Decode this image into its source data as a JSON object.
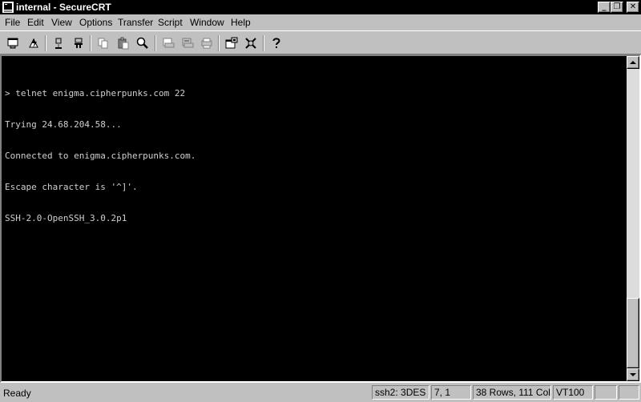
{
  "window": {
    "title": "internal - SecureCRT",
    "controls": {
      "minimize": "_",
      "maximize": "❐",
      "close": "✕"
    }
  },
  "menu": [
    "File",
    "Edit",
    "View",
    "Options",
    "Transfer",
    "Script",
    "Window",
    "Help"
  ],
  "toolbar": {
    "buttons": [
      "connect-icon",
      "quick-connect-icon",
      "connect-tab-icon",
      "disconnect-icon",
      "copy-icon",
      "paste-icon",
      "find-icon",
      "print-icon",
      "print-selection-icon",
      "print-setup-icon",
      "session-options-icon",
      "global-options-icon",
      "help-icon"
    ]
  },
  "terminal": {
    "lines": [
      "> telnet enigma.cipherpunks.com 22",
      "Trying 24.68.204.58...",
      "Connected to enigma.cipherpunks.com.",
      "Escape character is '^]'.",
      "SSH-2.0-OpenSSH_3.0.2p1"
    ],
    "background": "#000000",
    "foreground": "#d0d0d0"
  },
  "status": {
    "ready": "Ready",
    "cipher": "ssh2: 3DES",
    "position": "7,  1",
    "size": "38 Rows, 111 Cols",
    "emulation": "VT100"
  }
}
